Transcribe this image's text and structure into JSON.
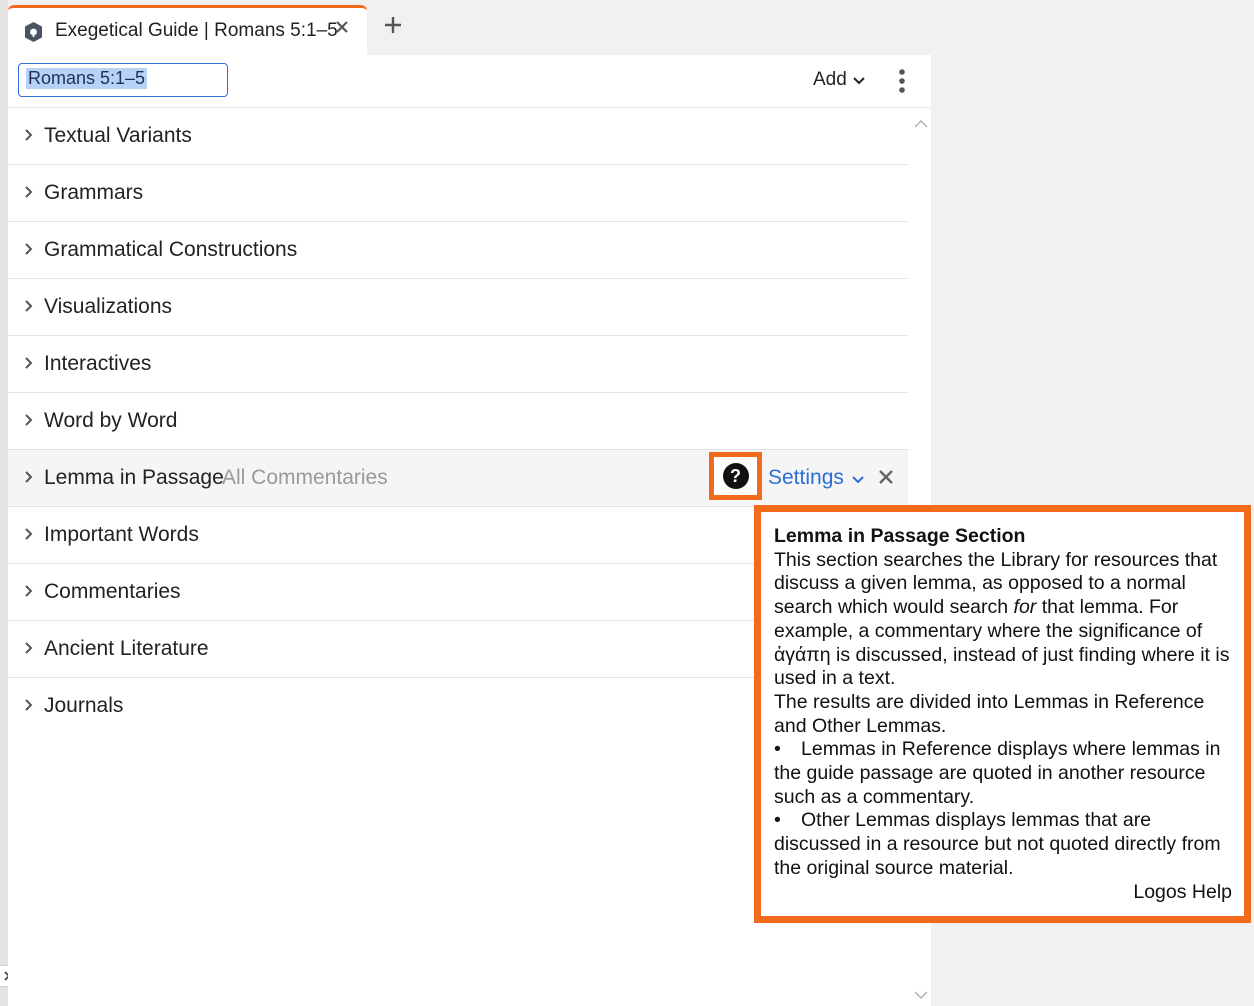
{
  "tab": {
    "title": "Exegetical Guide | Romans 5:1–5"
  },
  "toolbar": {
    "reference_value": "Romans 5:1–5",
    "add_label": "Add"
  },
  "sections": [
    {
      "label": "Textual Variants"
    },
    {
      "label": "Grammars"
    },
    {
      "label": "Grammatical Constructions"
    },
    {
      "label": "Visualizations"
    },
    {
      "label": "Interactives"
    },
    {
      "label": "Word by Word"
    },
    {
      "label": "Lemma in Passage",
      "sub": "All Commentaries",
      "help": "?",
      "settings_label": "Settings"
    },
    {
      "label": "Important Words"
    },
    {
      "label": "Commentaries"
    },
    {
      "label": "Ancient Literature"
    },
    {
      "label": "Journals"
    }
  ],
  "tooltip": {
    "title": "Lemma in Passage Section",
    "p1_a": "This section searches the Library for resources that discuss a given lemma, as opposed to a normal search which would search ",
    "p1_em": "for",
    "p1_b": " that lemma. For example, a commentary where the significance of ἀγάπη is discussed, instead of just finding where it is used in a text.",
    "p2": "The results are divided into Lemmas in Reference and Other Lemmas.",
    "bullets": [
      "Lemmas in Reference displays where lemmas in the guide passage are quoted in another resource such as a commentary.",
      "Other Lemmas displays lemmas that are discussed in a resource but not quoted directly from the original source material."
    ],
    "bullet_char": "•",
    "link": "Logos Help"
  },
  "colors": {
    "accent": "#f26b1d",
    "link": "#2c6ed5",
    "muted": "#9a9a9a"
  }
}
